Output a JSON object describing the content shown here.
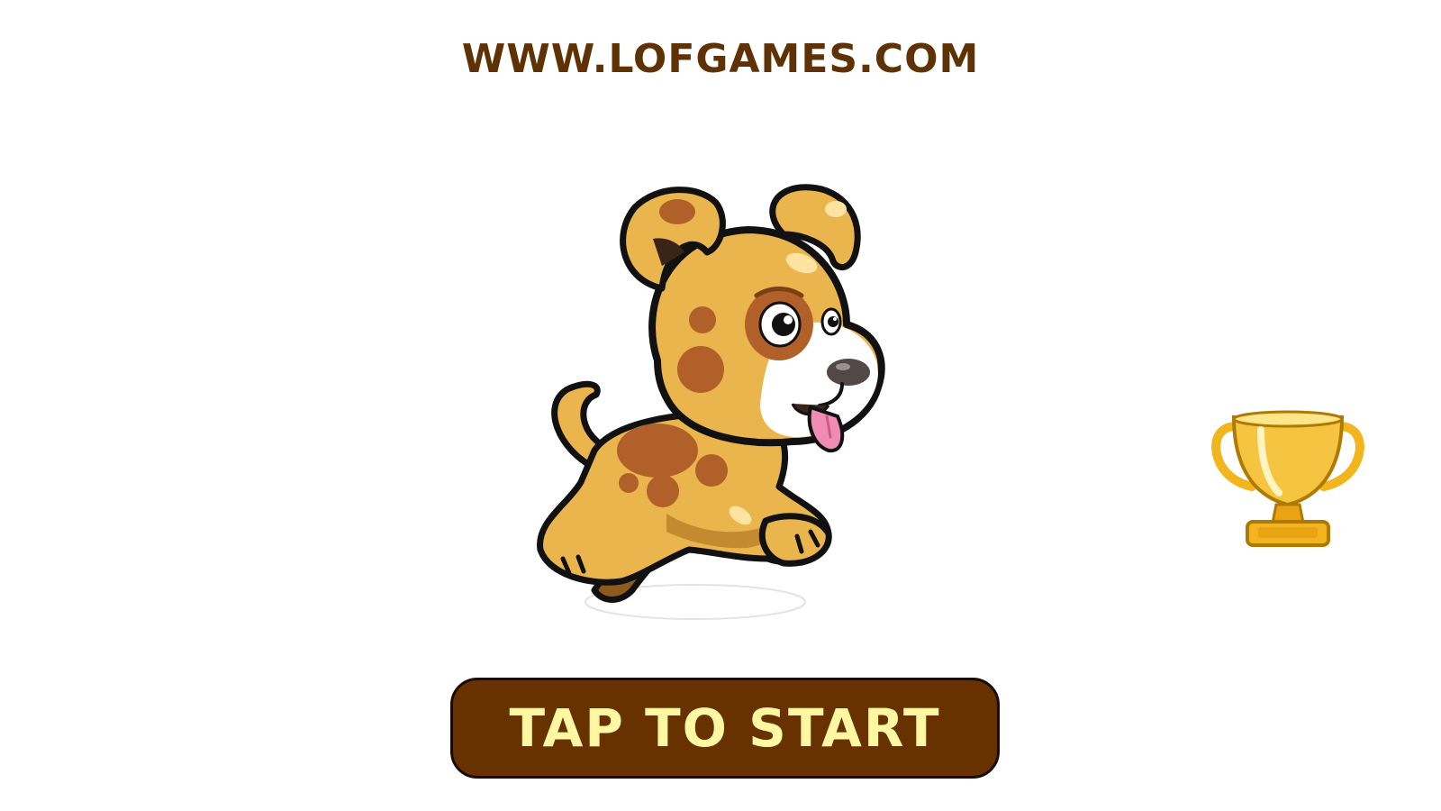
{
  "site": {
    "url_text": "WWW.LOFGAMES.COM"
  },
  "start_button": {
    "label": "TAP TO START"
  },
  "icons": {
    "mascot": "puppy-mascot-icon",
    "leaderboard": "trophy-icon"
  },
  "colors": {
    "background": "#ffffff",
    "title_text": "#5e3205",
    "button_fill": "#673100",
    "button_text": "#fff7a2",
    "dog_body": "#eab54d",
    "dog_spots": "#b06028",
    "trophy_gold": "#f2b51e"
  }
}
